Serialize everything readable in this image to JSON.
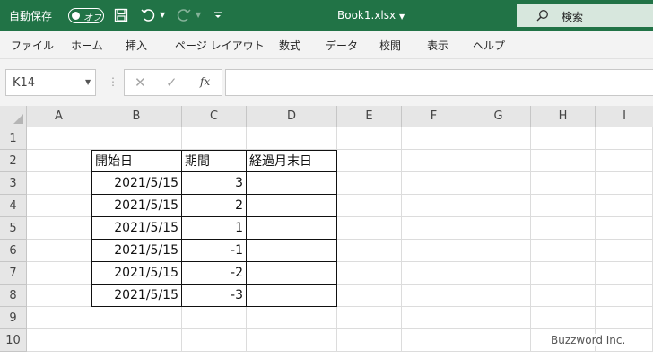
{
  "titlebar": {
    "autosave_label": "自動保存",
    "autosave_state": "オフ",
    "doc_title": "Book1.xlsx",
    "search_placeholder": "検索",
    "theme_color": "#217346"
  },
  "menu": {
    "items": [
      "ファイル",
      "ホーム",
      "挿入",
      "ページ レイアウト",
      "数式",
      "データ",
      "校閲",
      "表示",
      "ヘルプ"
    ]
  },
  "formula_bar": {
    "name_box": "K14",
    "fx_label": "fx",
    "formula": ""
  },
  "grid": {
    "columns": [
      "A",
      "B",
      "C",
      "D",
      "E",
      "F",
      "G",
      "H",
      "I"
    ],
    "rows": [
      "1",
      "2",
      "3",
      "4",
      "5",
      "6",
      "7",
      "8",
      "9",
      "10"
    ],
    "table": {
      "headers": [
        "開始日",
        "期間",
        "経過月末日"
      ],
      "data": [
        [
          "2021/5/15",
          "3",
          ""
        ],
        [
          "2021/5/15",
          "2",
          ""
        ],
        [
          "2021/5/15",
          "1",
          ""
        ],
        [
          "2021/5/15",
          "-1",
          ""
        ],
        [
          "2021/5/15",
          "-2",
          ""
        ],
        [
          "2021/5/15",
          "-3",
          ""
        ]
      ]
    }
  },
  "watermark": "Buzzword Inc."
}
